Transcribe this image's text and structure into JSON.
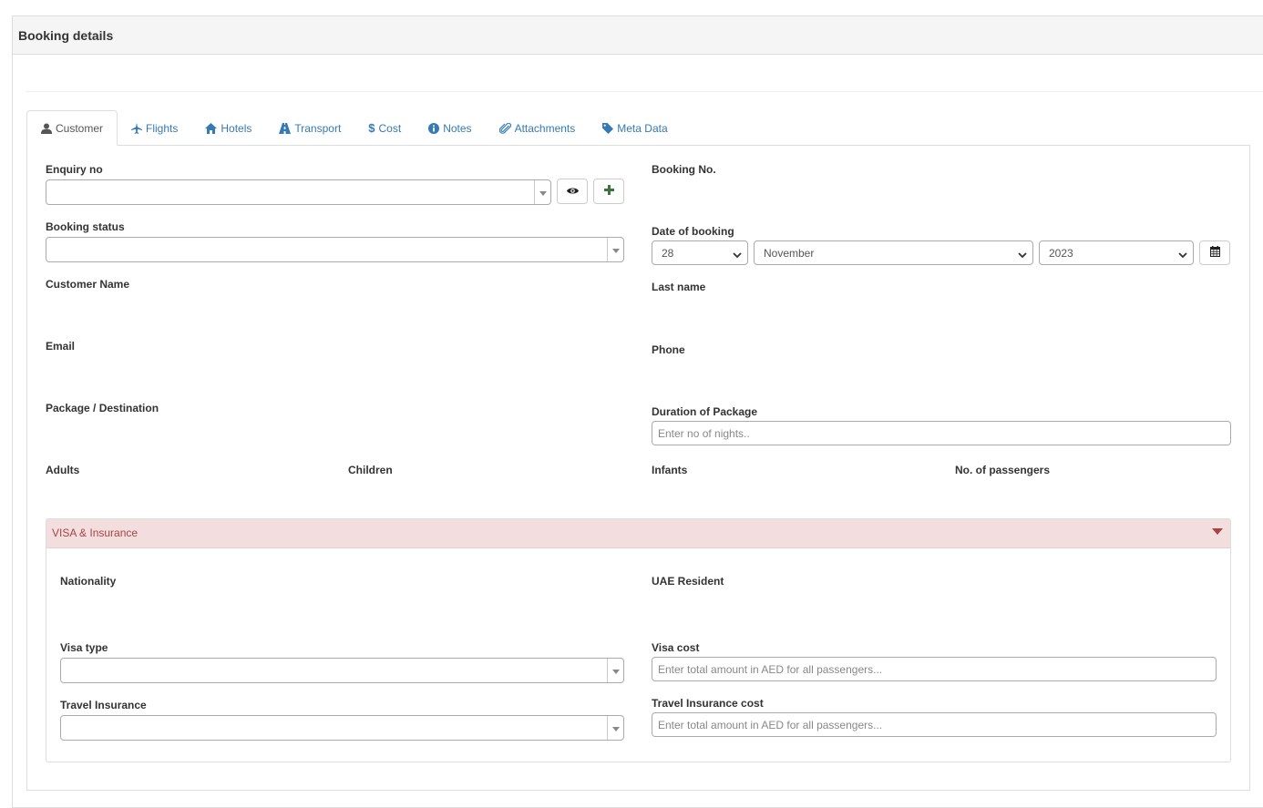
{
  "panel": {
    "title": "Booking details"
  },
  "tabs": [
    {
      "label": "Customer",
      "icon": "user-icon"
    },
    {
      "label": "Flights",
      "icon": "plane-icon"
    },
    {
      "label": "Hotels",
      "icon": "home-icon"
    },
    {
      "label": "Transport",
      "icon": "road-icon"
    },
    {
      "label": "Cost",
      "icon": "dollar-icon"
    },
    {
      "label": "Notes",
      "icon": "info-circle-icon"
    },
    {
      "label": "Attachments",
      "icon": "paperclip-icon"
    },
    {
      "label": "Meta Data",
      "icon": "tag-icon"
    }
  ],
  "form": {
    "enquiry_no": {
      "label": "Enquiry no",
      "value": ""
    },
    "booking_no": {
      "label": "Booking No."
    },
    "booking_status": {
      "label": "Booking status",
      "value": ""
    },
    "date_of_booking": {
      "label": "Date of booking",
      "day": "28",
      "month": "November",
      "year": "2023"
    },
    "customer_name": {
      "label": "Customer Name"
    },
    "last_name": {
      "label": "Last name"
    },
    "email": {
      "label": "Email"
    },
    "phone": {
      "label": "Phone"
    },
    "package_destination": {
      "label": "Package / Destination"
    },
    "duration": {
      "label": "Duration of Package",
      "placeholder": "Enter no of nights.."
    },
    "adults": {
      "label": "Adults"
    },
    "children": {
      "label": "Children"
    },
    "infants": {
      "label": "Infants"
    },
    "passengers": {
      "label": "No. of passengers"
    }
  },
  "visa_panel": {
    "title": "VISA & Insurance",
    "nationality": {
      "label": "Nationality"
    },
    "uae_resident": {
      "label": "UAE Resident"
    },
    "visa_type": {
      "label": "Visa type",
      "value": ""
    },
    "visa_cost": {
      "label": "Visa cost",
      "placeholder": "Enter total amount in AED for all passengers..."
    },
    "travel_insurance": {
      "label": "Travel Insurance",
      "value": ""
    },
    "travel_insurance_cost": {
      "label": "Travel Insurance cost",
      "placeholder": "Enter total amount in AED for all passengers..."
    }
  },
  "colors": {
    "link": "#337ab7",
    "danger_bg": "#f2dede",
    "danger_text": "#a94442",
    "success": "#3c763d"
  }
}
